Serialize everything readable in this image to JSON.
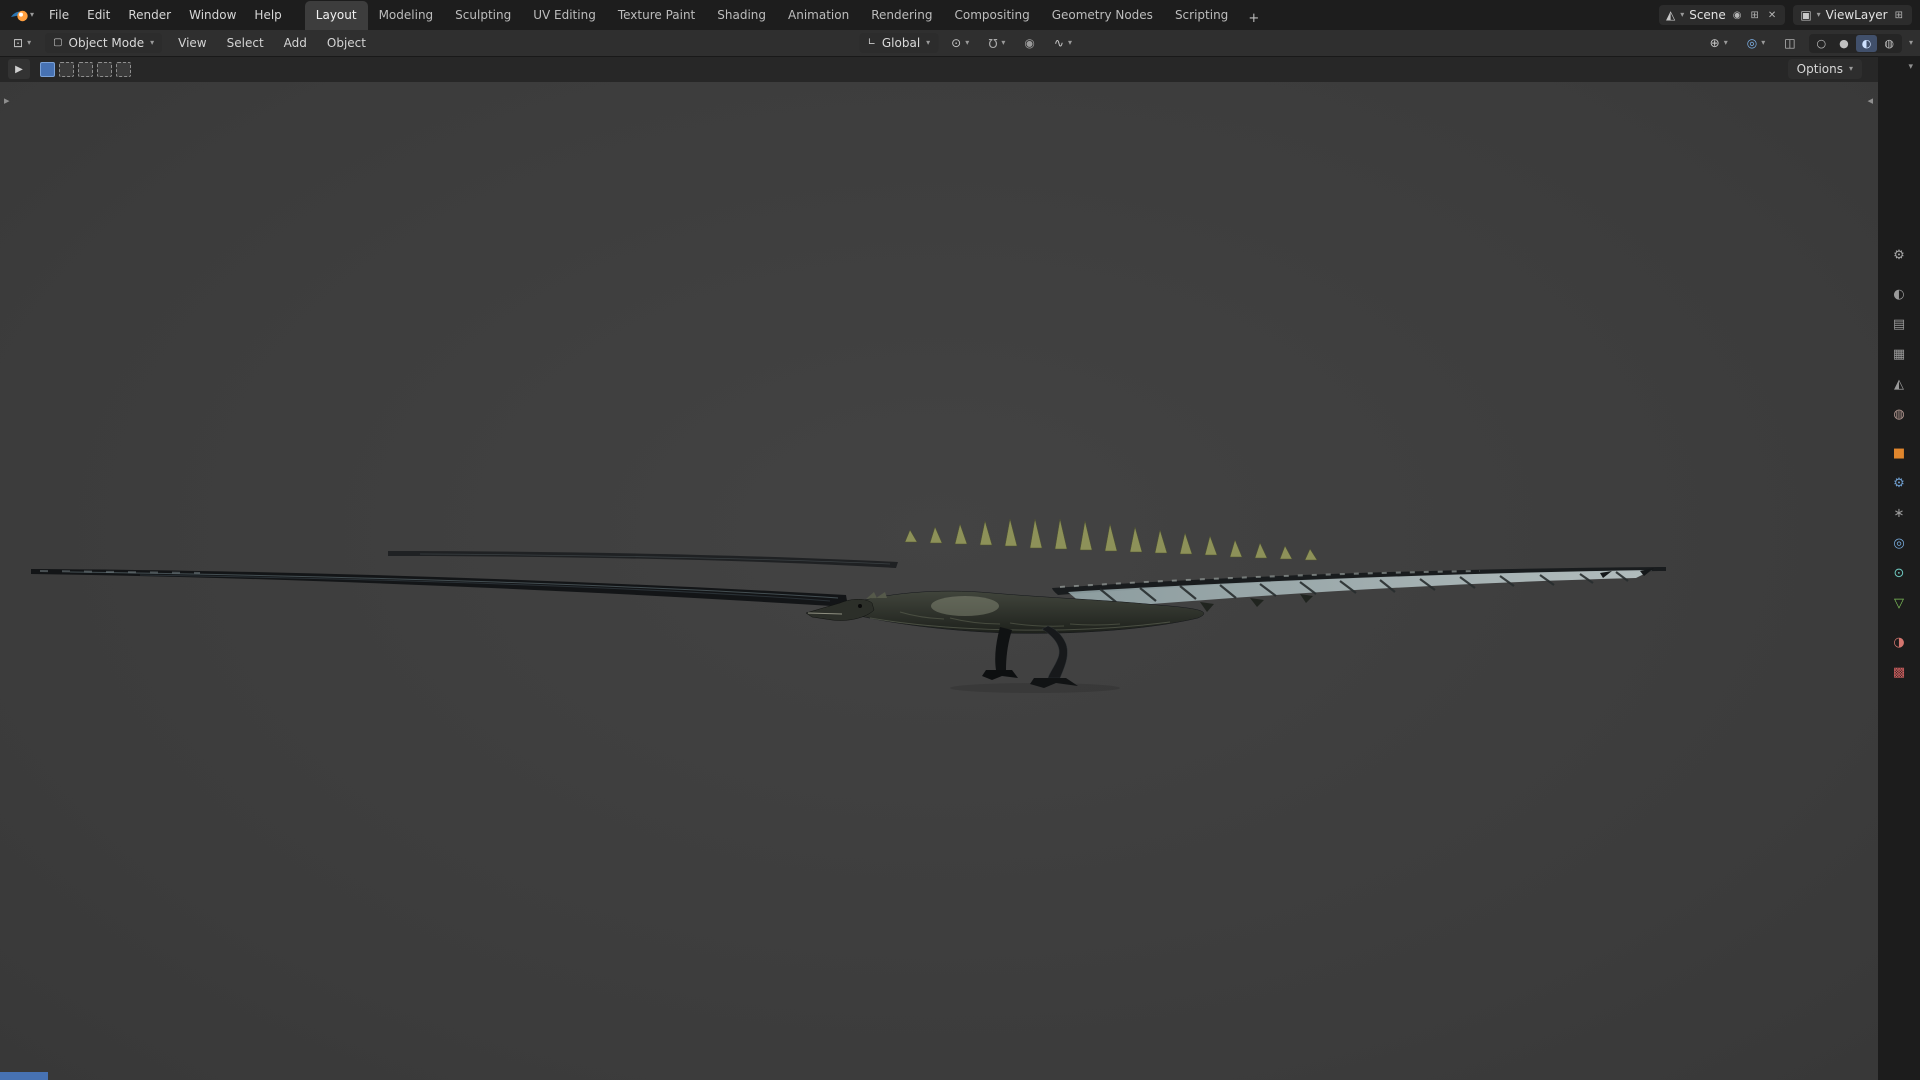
{
  "colors": {
    "accent": "#4772b3",
    "topbar-bg": "#1d1d1d",
    "header-bg": "#2f2f2f",
    "toolbar-bg": "#272727",
    "viewport-bg": "#3e3e3e",
    "rail-bg": "#1c1c1c",
    "widget-bg": "#2c2c2c",
    "tab-active-bg": "#3d3d3d",
    "text": "#dadada",
    "text-dim": "#b0b0b0"
  },
  "topbar": {
    "menus": [
      "File",
      "Edit",
      "Render",
      "Window",
      "Help"
    ],
    "workspaces": [
      "Layout",
      "Modeling",
      "Sculpting",
      "UV Editing",
      "Texture Paint",
      "Shading",
      "Animation",
      "Rendering",
      "Compositing",
      "Geometry Nodes",
      "Scripting"
    ],
    "active_workspace": "Layout",
    "add_tab": "+",
    "scene": {
      "icon": "◭",
      "label": "Scene",
      "pin": "◉",
      "new": "⊞",
      "unlink": "✕"
    },
    "view_layer": {
      "icon": "▣",
      "label": "ViewLayer",
      "new": "⊞"
    }
  },
  "header": {
    "editor_icon": "⊡",
    "mode_icon": "▢",
    "mode": "Object Mode",
    "menus": [
      "View",
      "Select",
      "Add",
      "Object"
    ],
    "orientation_icon": "∟",
    "orientation": "Global",
    "pivot_icon": "⊙",
    "magnet_icon": "Ω",
    "snap_icon": "▸",
    "prop_edit_icon": "◉",
    "falloff_icon": "∿",
    "gizmo_icon": "⊕",
    "overlays_icon": "◎",
    "xray_icon": "◫",
    "caret": "▾",
    "shading": [
      {
        "name": "wireframe",
        "glyph": "○"
      },
      {
        "name": "solid",
        "glyph": "●"
      },
      {
        "name": "material-preview",
        "glyph": "◐"
      },
      {
        "name": "rendered",
        "glyph": "◍"
      }
    ],
    "active_shading": "material-preview"
  },
  "tools": {
    "active_tool_icon": "▶",
    "options_label": "Options"
  },
  "viewport": {
    "toolbar_toggle": "▸",
    "sidebar_toggle": "◂"
  },
  "props": {
    "menu_caret": "▾",
    "tabs": [
      {
        "name": "tool",
        "glyph": "⚙",
        "color": "#a8a8a8"
      },
      {
        "name": "render",
        "glyph": "◐",
        "color": "#9a9a9a"
      },
      {
        "name": "output",
        "glyph": "▤",
        "color": "#9a9a9a"
      },
      {
        "name": "view-layer",
        "glyph": "▦",
        "color": "#9a9a9a"
      },
      {
        "name": "scene",
        "glyph": "◭",
        "color": "#9a9a9a"
      },
      {
        "name": "world",
        "glyph": "◍",
        "color": "#b59a93"
      },
      {
        "name": "object",
        "glyph": "■",
        "color": "#e0862d"
      },
      {
        "name": "modifiers",
        "glyph": "⚙",
        "color": "#6f9fd0"
      },
      {
        "name": "particles",
        "glyph": "∗",
        "color": "#9a9a9a"
      },
      {
        "name": "physics",
        "glyph": "◎",
        "color": "#79aee0"
      },
      {
        "name": "constraints",
        "glyph": "⊙",
        "color": "#6fc9c0"
      },
      {
        "name": "data",
        "glyph": "▽",
        "color": "#7fc05a"
      },
      {
        "name": "material",
        "glyph": "◑",
        "color": "#d4766f"
      },
      {
        "name": "texture",
        "glyph": "▩",
        "color": "#cf5f5f"
      }
    ]
  }
}
